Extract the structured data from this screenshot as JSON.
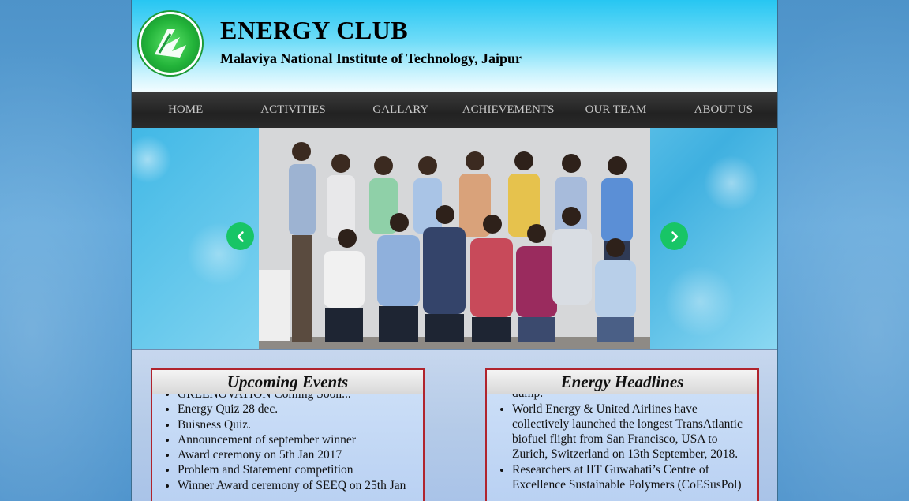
{
  "header": {
    "title": "ENERGY CLUB",
    "subtitle": "Malaviya National Institute of Technology, Jaipur"
  },
  "nav": {
    "items": [
      "HOME",
      "ACTIVITIES",
      "GALLARY",
      "ACHIEVEMENTS",
      "OUR TEAM",
      "ABOUT US"
    ]
  },
  "colors": {
    "accent_green": "#18c566",
    "box_border": "#b0242d",
    "nav_bg": "#262626"
  },
  "events": {
    "title": "Upcoming Events",
    "items": [
      "GREENOVATION Coming Soon...",
      "Energy Quiz 28 dec.",
      "Buisness Quiz.",
      "Announcement of september winner",
      "Award ceremony on 5th Jan 2017",
      "Problem and Statement competition",
      "Winner Award ceremony of SEEQ on 25th Jan"
    ]
  },
  "headlines": {
    "title": "Energy Headlines",
    "items": [
      "turned into an artificial island from a garbage dump.",
      "World Energy & United Airlines have collectively launched the longest TransAtlantic biofuel flight from San Francisco, USA to Zurich, Switzerland on 13th September, 2018.",
      "Researchers at IIT Guwahati’s Centre of Excellence Sustainable Polymers (CoESusPol)"
    ]
  },
  "icons": {
    "logo": "energy-club-logo",
    "prev": "chevron-left-icon",
    "next": "chevron-right-icon"
  }
}
